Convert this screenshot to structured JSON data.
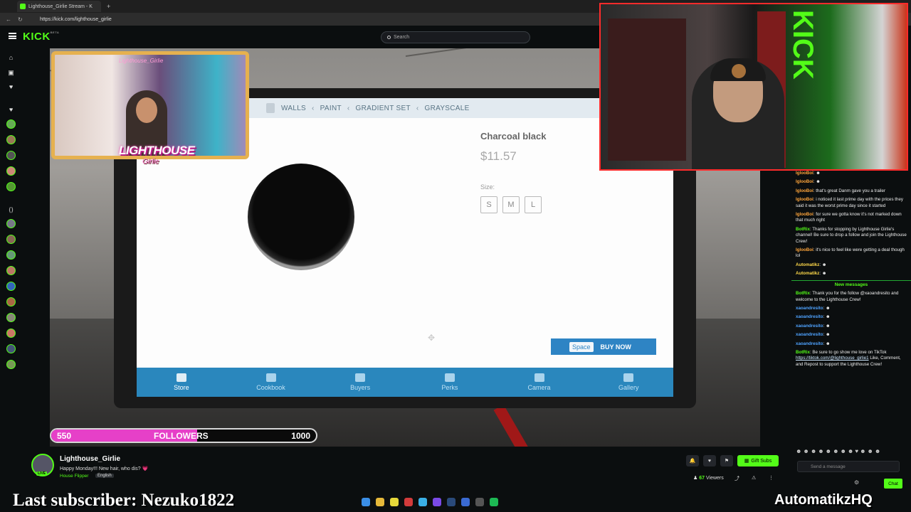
{
  "browser": {
    "tab_title": "Lighthouse_Girlie Stream - K",
    "url": "https://kick.com/lighthouse_girlie"
  },
  "kick": {
    "logo": "KICK",
    "logo_beta": "BETA",
    "search_placeholder": "Search"
  },
  "game": {
    "breadcrumbs": [
      "WALLS",
      "PAINT",
      "GRADIENT SET",
      "GRAYSCALE"
    ],
    "product_name": "Charcoal black",
    "price": "$11.57",
    "size_label": "Size:",
    "sizes": [
      "S",
      "M",
      "L"
    ],
    "buy_key": "Space",
    "buy_label": "BUY NOW",
    "tabs": [
      "Store",
      "Cookbook",
      "Buyers",
      "Perks",
      "Camera",
      "Gallery"
    ],
    "active_tab": "Store"
  },
  "overlay": {
    "cam_title": "Lighthouse_Girlie",
    "logo_line1": "LIGHTHOUSE",
    "logo_line2": "Girlie",
    "followers_current": "550",
    "followers_label": "FOLLOWERS",
    "followers_goal": "1000",
    "followers_progress": 0.55,
    "last_subscriber": "Last subscriber: Nezuko1822",
    "brand": "AutomatikzHQ"
  },
  "channel": {
    "name": "Lighthouse_Girlie",
    "title": "Happy Monday!!! New hair, who dis? 💗",
    "game": "House Flipper",
    "language": "English",
    "live_badge": "LIVE",
    "gift_subs": "Gift Subs",
    "viewers_count": "67",
    "viewers_label": "Viewers"
  },
  "chat": {
    "messages": [
      {
        "user": "IglooBoi",
        "text": ""
      },
      {
        "user": "IglooBoi",
        "text": ""
      },
      {
        "user": "IglooBoi",
        "text": "that's great Danm gave you a trailer"
      },
      {
        "user": "IglooBoi",
        "text": "i noticed it last prime day with the prices they said it was the worst prime day since it started"
      },
      {
        "user": "IglooBoi",
        "text": "for sure we gotta know it's not marked down that much right"
      },
      {
        "user": "BotRix",
        "text": "Thanks for stopping by Lighthouse Girlie's channel! Be sure to drop a follow and join the Lighthouse Crew!"
      },
      {
        "user": "IglooBoi",
        "text": "it's nice to feel like were getting a deal though lol"
      },
      {
        "user": "Automatikz",
        "text": ""
      },
      {
        "user": "Automatikz",
        "text": ""
      }
    ],
    "new_messages_label": "New messages",
    "new_messages": [
      {
        "user": "BotRix",
        "text": "Thank you for the follow @xaoandresito and welcome to the Lighthouse Crew!"
      },
      {
        "user": "xaoandresito",
        "text": ""
      },
      {
        "user": "xaoandresito",
        "text": ""
      },
      {
        "user": "xaoandresito",
        "text": ""
      },
      {
        "user": "xaoandresito",
        "text": ""
      },
      {
        "user": "xaoandresito",
        "text": ""
      },
      {
        "user": "BotRix",
        "text": "Be sure to go show me love on TikTok",
        "link": "https://tiktok.com/@lighthouse_girlie1",
        "after": "Like, Comment, and Repost to support the Lighthouse Crew!"
      }
    ],
    "input_placeholder": "Send a message",
    "send_label": "Chat"
  }
}
